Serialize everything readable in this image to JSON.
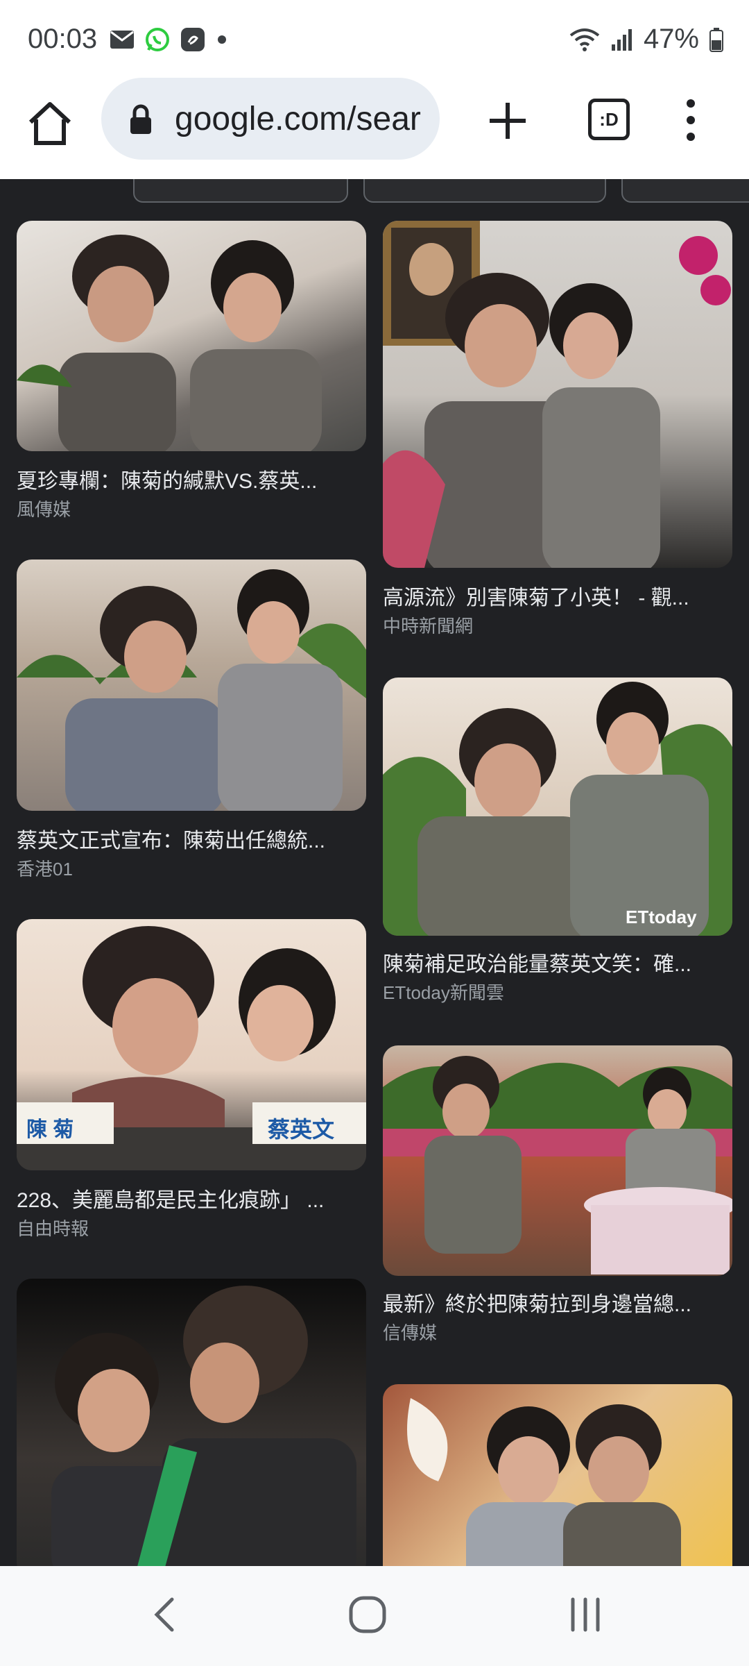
{
  "status": {
    "time": "00:03",
    "battery": "47%",
    "icons": [
      "mail-icon",
      "whatsapp-icon",
      "evernote-icon",
      "dot-icon",
      "wifi-icon",
      "signal-icon",
      "battery-icon"
    ]
  },
  "toolbar": {
    "url": "google.com/sear",
    "tab_switcher_label": ":D",
    "icons": [
      "home-icon",
      "lock-icon",
      "plus-icon",
      "tab-switcher-icon",
      "overflow-menu-icon"
    ]
  },
  "results": {
    "left": [
      {
        "title": "夏珍專欄：陳菊的緘默VS.蔡英...",
        "source": "風傳媒"
      },
      {
        "title": "蔡英文正式宣布：陳菊出任總統...",
        "source": "香港01"
      },
      {
        "title": "228、美麗島都是民主化痕跡」 ...",
        "source": "自由時報",
        "image_labels": [
          "陳 菊",
          "蔡英文"
        ]
      },
      {
        "title": "",
        "source": ""
      }
    ],
    "right": [
      {
        "title": "高源流》別害陳菊了小英！ - 觀...",
        "source": "中時新聞網"
      },
      {
        "title": "陳菊補足政治能量蔡英文笑：確...",
        "source": "ETtoday新聞雲",
        "image_labels": [
          "ETtoday"
        ]
      },
      {
        "title": "最新》終於把陳菊拉到身邊當總...",
        "source": "信傳媒"
      },
      {
        "title": "",
        "source": ""
      }
    ]
  },
  "colors": {
    "background": "#202124",
    "title_text": "#e8eaed",
    "source_text": "#9aa0a6",
    "status_bar": "#ffffff",
    "omnibox": "#e8edf3",
    "nav_bar": "#f8f9fa"
  }
}
